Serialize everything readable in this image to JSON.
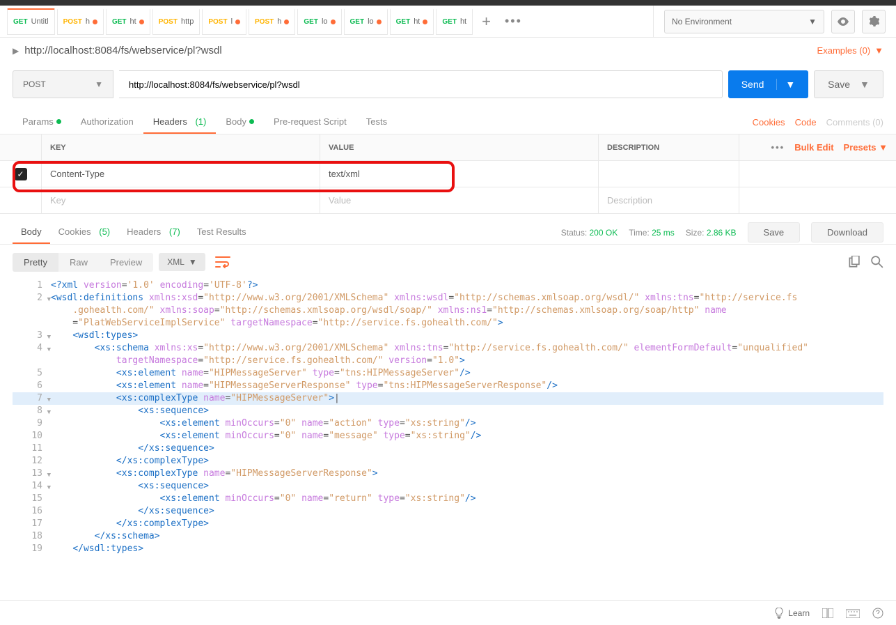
{
  "env": {
    "name": "No Environment"
  },
  "tabs": [
    {
      "method": "GET",
      "title": "Untitl",
      "dot": false
    },
    {
      "method": "POST",
      "title": "h",
      "dot": true
    },
    {
      "method": "GET",
      "title": "ht",
      "dot": true
    },
    {
      "method": "POST",
      "title": "http",
      "dot": false
    },
    {
      "method": "POST",
      "title": "l",
      "dot": true
    },
    {
      "method": "POST",
      "title": "h",
      "dot": true
    },
    {
      "method": "GET",
      "title": "lo",
      "dot": true
    },
    {
      "method": "GET",
      "title": "lo",
      "dot": true
    },
    {
      "method": "GET",
      "title": "ht",
      "dot": true
    },
    {
      "method": "GET",
      "title": "ht",
      "dot": false
    }
  ],
  "request": {
    "title": "http://localhost:8084/fs/webservice/pl?wsdl",
    "examples": "Examples (0)",
    "method": "POST",
    "url": "http://localhost:8084/fs/webservice/pl?wsdl",
    "send": "Send",
    "save": "Save"
  },
  "reqTabs": {
    "params": "Params",
    "auth": "Authorization",
    "headers": "Headers",
    "headersCount": "(1)",
    "body": "Body",
    "pre": "Pre-request Script",
    "tests": "Tests",
    "cookies": "Cookies",
    "code": "Code",
    "comments": "Comments (0)"
  },
  "hdrGrid": {
    "key": "KEY",
    "value": "VALUE",
    "desc": "DESCRIPTION",
    "bulk": "Bulk Edit",
    "presets": "Presets",
    "rows": [
      {
        "checked": true,
        "key": "Content-Type",
        "value": "text/xml"
      }
    ],
    "placeholders": {
      "key": "Key",
      "value": "Value",
      "desc": "Description"
    }
  },
  "respTabs": {
    "body": "Body",
    "cookies": "Cookies",
    "cookiesCount": "(5)",
    "headers": "Headers",
    "headersCount": "(7)",
    "tests": "Test Results"
  },
  "status": {
    "statusLbl": "Status:",
    "statusVal": "200 OK",
    "timeLbl": "Time:",
    "timeVal": "25 ms",
    "sizeLbl": "Size:",
    "sizeVal": "2.86 KB",
    "save": "Save",
    "download": "Download"
  },
  "format": {
    "pretty": "Pretty",
    "raw": "Raw",
    "preview": "Preview",
    "lang": "XML"
  },
  "bottom": {
    "learn": "Learn"
  },
  "codeLines": [
    {
      "n": "1",
      "fold": "",
      "html": "<span class='tag'>&lt;?xml</span> <span class='attr'>version</span>=<span class='str'>'1.0'</span> <span class='attr'>encoding</span>=<span class='str'>'UTF-8'</span><span class='tag'>?&gt;</span>"
    },
    {
      "n": "2",
      "fold": "▼",
      "html": "<span class='tag'>&lt;wsdl:definitions</span> <span class='attr'>xmlns:xsd</span>=<span class='str'>\"http://www.w3.org/2001/XMLSchema\"</span> <span class='attr'>xmlns:wsdl</span>=<span class='str'>\"http://schemas.xmlsoap.org/wsdl/\"</span> <span class='attr'>xmlns:tns</span>=<span class='str'>\"http://service.fs</span>"
    },
    {
      "n": "",
      "fold": "",
      "html": "    <span class='str'>.gohealth.com/\"</span> <span class='attr'>xmlns:soap</span>=<span class='str'>\"http://schemas.xmlsoap.org/wsdl/soap/\"</span> <span class='attr'>xmlns:ns1</span>=<span class='str'>\"http://schemas.xmlsoap.org/soap/http\"</span> <span class='attr'>name</span>"
    },
    {
      "n": "",
      "fold": "",
      "html": "    =<span class='str'>\"PlatWebServiceImplService\"</span> <span class='attr'>targetNamespace</span>=<span class='str'>\"http://service.fs.gohealth.com/\"</span><span class='tag'>&gt;</span>"
    },
    {
      "n": "3",
      "fold": "▼",
      "html": "    <span class='tag'>&lt;wsdl:types&gt;</span>"
    },
    {
      "n": "4",
      "fold": "▼",
      "html": "        <span class='tag'>&lt;xs:schema</span> <span class='attr'>xmlns:xs</span>=<span class='str'>\"http://www.w3.org/2001/XMLSchema\"</span> <span class='attr'>xmlns:tns</span>=<span class='str'>\"http://service.fs.gohealth.com/\"</span> <span class='attr'>elementFormDefault</span>=<span class='str'>\"unqualified\"</span>"
    },
    {
      "n": "",
      "fold": "",
      "html": "            <span class='attr'>targetNamespace</span>=<span class='str'>\"http://service.fs.gohealth.com/\"</span> <span class='attr'>version</span>=<span class='str'>\"1.0\"</span><span class='tag'>&gt;</span>"
    },
    {
      "n": "5",
      "fold": "",
      "html": "            <span class='tag'>&lt;xs:element</span> <span class='attr'>name</span>=<span class='str'>\"HIPMessageServer\"</span> <span class='attr'>type</span>=<span class='str'>\"tns:HIPMessageServer\"</span><span class='tag'>/&gt;</span>"
    },
    {
      "n": "6",
      "fold": "",
      "html": "            <span class='tag'>&lt;xs:element</span> <span class='attr'>name</span>=<span class='str'>\"HIPMessageServerResponse\"</span> <span class='attr'>type</span>=<span class='str'>\"tns:HIPMessageServerResponse\"</span><span class='tag'>/&gt;</span>"
    },
    {
      "n": "7",
      "fold": "▼",
      "html": "            <span class='tag'>&lt;xs:complexType</span> <span class='attr'>name</span>=<span class='str'>\"HIPMessageServer\"</span><span class='tag'>&gt;</span>|",
      "hl": true
    },
    {
      "n": "8",
      "fold": "▼",
      "html": "                <span class='tag'>&lt;xs:sequence&gt;</span>"
    },
    {
      "n": "9",
      "fold": "",
      "html": "                    <span class='tag'>&lt;xs:element</span> <span class='attr'>minOccurs</span>=<span class='str'>\"0\"</span> <span class='attr'>name</span>=<span class='str'>\"action\"</span> <span class='attr'>type</span>=<span class='str'>\"xs:string\"</span><span class='tag'>/&gt;</span>"
    },
    {
      "n": "10",
      "fold": "",
      "html": "                    <span class='tag'>&lt;xs:element</span> <span class='attr'>minOccurs</span>=<span class='str'>\"0\"</span> <span class='attr'>name</span>=<span class='str'>\"message\"</span> <span class='attr'>type</span>=<span class='str'>\"xs:string\"</span><span class='tag'>/&gt;</span>"
    },
    {
      "n": "11",
      "fold": "",
      "html": "                <span class='tag'>&lt;/xs:sequence&gt;</span>"
    },
    {
      "n": "12",
      "fold": "",
      "html": "            <span class='tag'>&lt;/xs:complexType&gt;</span>"
    },
    {
      "n": "13",
      "fold": "▼",
      "html": "            <span class='tag'>&lt;xs:complexType</span> <span class='attr'>name</span>=<span class='str'>\"HIPMessageServerResponse\"</span><span class='tag'>&gt;</span>"
    },
    {
      "n": "14",
      "fold": "▼",
      "html": "                <span class='tag'>&lt;xs:sequence&gt;</span>"
    },
    {
      "n": "15",
      "fold": "",
      "html": "                    <span class='tag'>&lt;xs:element</span> <span class='attr'>minOccurs</span>=<span class='str'>\"0\"</span> <span class='attr'>name</span>=<span class='str'>\"return\"</span> <span class='attr'>type</span>=<span class='str'>\"xs:string\"</span><span class='tag'>/&gt;</span>"
    },
    {
      "n": "16",
      "fold": "",
      "html": "                <span class='tag'>&lt;/xs:sequence&gt;</span>"
    },
    {
      "n": "17",
      "fold": "",
      "html": "            <span class='tag'>&lt;/xs:complexType&gt;</span>"
    },
    {
      "n": "18",
      "fold": "",
      "html": "        <span class='tag'>&lt;/xs:schema&gt;</span>"
    },
    {
      "n": "19",
      "fold": "",
      "html": "    <span class='tag'>&lt;/wsdl:types&gt;</span>"
    }
  ]
}
